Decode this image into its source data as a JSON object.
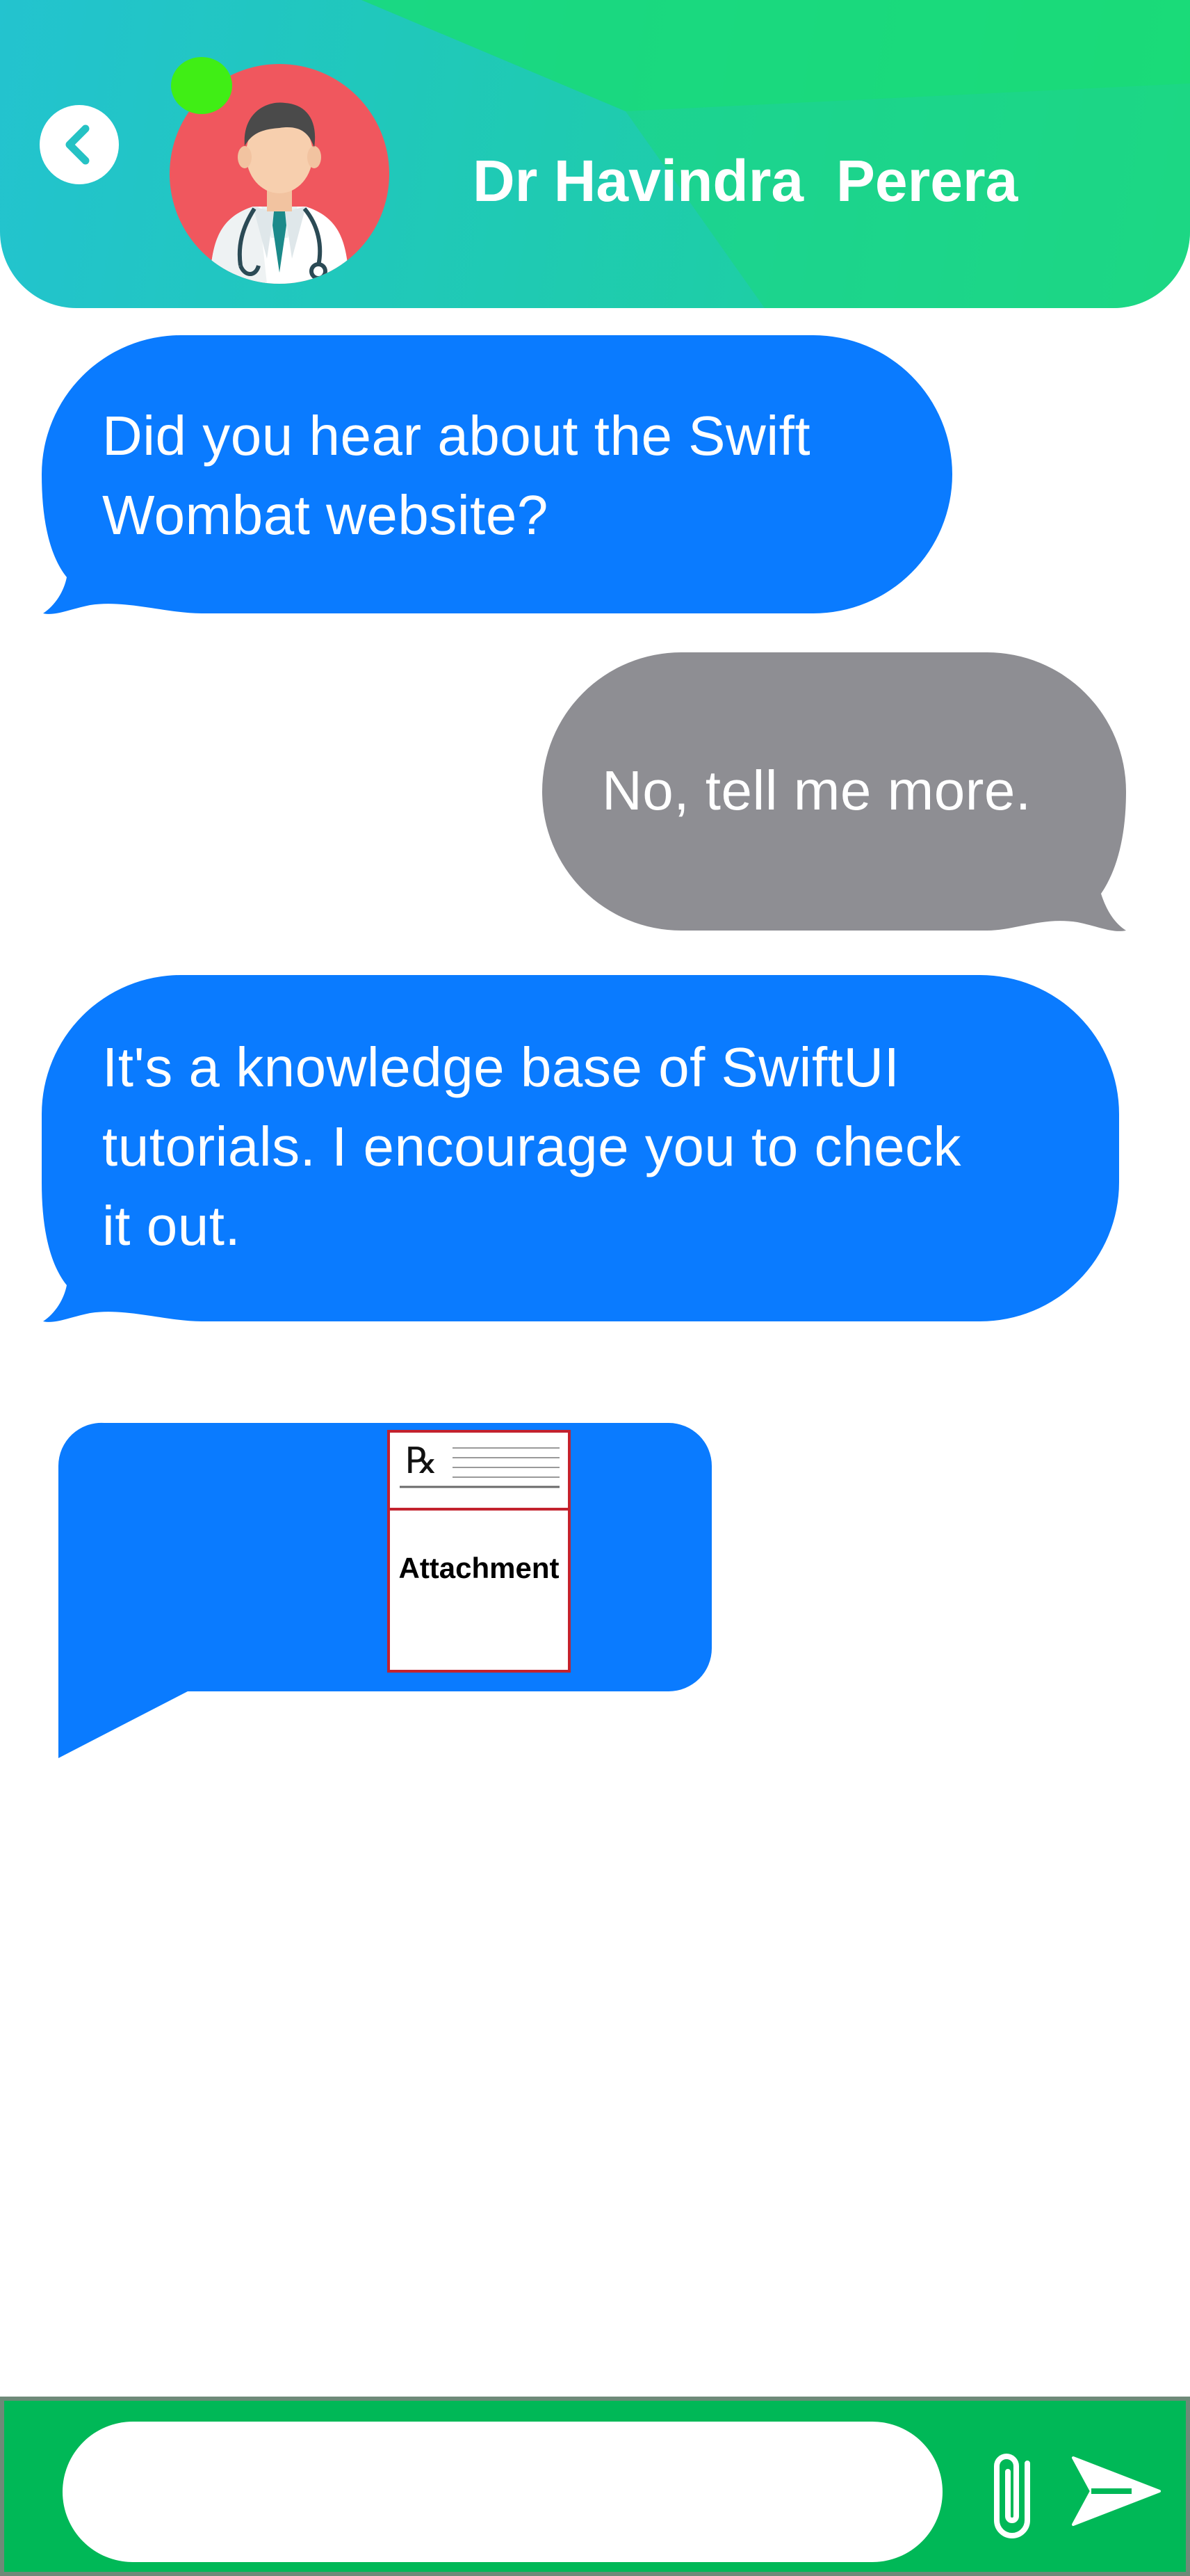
{
  "header": {
    "title": "Dr Havindra  Perera",
    "back_icon": "chevron-left-icon",
    "avatar_icon": "doctor-avatar-icon",
    "online_status": "online"
  },
  "messages": [
    {
      "side": "received",
      "lines": [
        "Did you hear about the Swift",
        "Wombat website?"
      ]
    },
    {
      "side": "sent",
      "lines": [
        "No, tell me more."
      ]
    },
    {
      "side": "received",
      "lines": [
        "It's a knowledge base of SwiftUI",
        "tutorials. I encourage you to check",
        "it out."
      ]
    }
  ],
  "attachment": {
    "label": "Attachment",
    "icon": "prescription-rx-icon",
    "rx_symbol": "℞"
  },
  "composer": {
    "value": "",
    "placeholder": "",
    "attach_icon": "paperclip-icon",
    "send_icon": "send-icon"
  },
  "colors": {
    "received_bubble": "#0a7bff",
    "sent_bubble": "#8e8e93",
    "header_start": "#23c3cf",
    "header_end": "#1dd58f",
    "input_bar": "#00b857",
    "online_dot": "#40ee15",
    "avatar_bg": "#f0575e"
  }
}
